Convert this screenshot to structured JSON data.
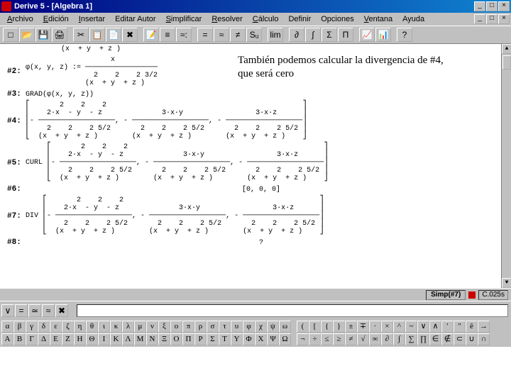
{
  "titlebar": {
    "title": "Derive 5 - [Algebra 1]"
  },
  "menubar": {
    "items": [
      "Archivo",
      "Edición",
      "Insertar",
      "Editar Autor",
      "Simplificar",
      "Resolver",
      "Cálculo",
      "Definir",
      "Opciones",
      "Ventana",
      "Ayuda"
    ]
  },
  "toolbar": {
    "icons": [
      "new-icon",
      "open-icon",
      "save-icon",
      "print-icon",
      "cut-icon",
      "copy-icon",
      "paste-icon",
      "delete-icon",
      "author-icon",
      "simplify-icon",
      "approx-icon",
      "equals-icon",
      "approxeq-icon",
      "unequal-icon",
      "sub-icon",
      "lim-icon",
      "partial-icon",
      "integral-icon",
      "sum-icon",
      "product-icon",
      "plot2d-icon",
      "plot3d-icon",
      "help-icon"
    ],
    "glyphs": [
      "□",
      "📂",
      "💾",
      "🖨",
      "✂",
      "📋",
      "📄",
      "✖",
      "📝",
      "≡",
      "≈:",
      "=",
      "≈",
      "≠",
      "Sᵤ",
      "lim",
      "∂",
      "∫",
      "Σ",
      "Π",
      "📈",
      "📊",
      "?"
    ]
  },
  "workspace": {
    "topline": "(x  + y  + z )",
    "rows": [
      {
        "label": "#2:",
        "expr": "                    x\nφ(x, y, z) := ─────────────────\n                2    2    2 3/2\n              (x  + y  + z )"
      },
      {
        "label": "#3:",
        "expr": "GRAD(φ(x, y, z))"
      },
      {
        "label": "#4:",
        "expr": "⎡       2    2    2                                              ⎤\n⎢    2·x  - y  - z              3·x·y                 3·x·z      ⎥\n⎢- ──────────────────, - ──────────────────, - ──────────────────⎥\n⎢    2    2    2 5/2       2    2    2 5/2       2    2    2 5/2 ⎥\n⎣  (x  + y  + z )        (x  + y  + z )        (x  + y  + z )    ⎦"
      },
      {
        "label": "#5:",
        "expr": "     ⎡       2    2    2                                              ⎤\n     ⎢    2·x  - y  - z              3·x·y                 3·x·z      ⎥\nCURL ⎢- ──────────────────, - ──────────────────, - ──────────────────⎥\n     ⎢    2    2    2 5/2       2    2    2 5/2       2    2    2 5/2 ⎥\n     ⎣  (x  + y  + z )        (x  + y  + z )        (x  + y  + z )    ⎦"
      },
      {
        "label": "#6:",
        "expr": "[0, 0, 0]",
        "center": true
      },
      {
        "label": "#7:",
        "expr": "    ⎡       2    2    2                                              ⎤\n    ⎢    2·x  - y  - z              3·x·y                 3·x·z      ⎥\nDIV ⎢- ──────────────────, - ──────────────────, - ──────────────────⎥\n    ⎢    2    2    2 5/2       2    2    2 5/2       2    2    2 5/2 ⎥\n    ⎣  (x  + y  + z )        (x  + y  + z )        (x  + y  + z )    ⎦"
      },
      {
        "label": "#8:",
        "expr": "?",
        "center": true
      }
    ]
  },
  "annotation": {
    "text": "También podemos calcular la divergencia de #4, que será cero"
  },
  "statusbar": {
    "center": "Simp(#7)",
    "time": "C.025s"
  },
  "inputbar": {
    "icons": [
      "∨",
      "=",
      "≃",
      "≈",
      "✖"
    ]
  },
  "greek": {
    "g1r1": [
      "α",
      "β",
      "γ",
      "δ",
      "ε",
      "ζ",
      "η",
      "θ",
      "ι",
      "κ",
      "λ",
      "μ",
      "ν",
      "ξ",
      "ο",
      "π",
      "ρ",
      "σ",
      "τ",
      "υ",
      "φ",
      "χ",
      "ψ",
      "ω"
    ],
    "g1r2": [
      "Α",
      "Β",
      "Γ",
      "Δ",
      "Ε",
      "Ζ",
      "Η",
      "Θ",
      "Ι",
      "Κ",
      "Λ",
      "Μ",
      "Ν",
      "Ξ",
      "Ο",
      "Π",
      "Ρ",
      "Σ",
      "Τ",
      "Υ",
      "Φ",
      "Χ",
      "Ψ",
      "Ω"
    ],
    "g2r1": [
      "(",
      "[",
      "{",
      "}",
      "±",
      "∓",
      "·",
      "×",
      "^",
      "~",
      "∨",
      "∧",
      "′",
      "″",
      "ê",
      "→"
    ],
    "g2r2": [
      "¬",
      "÷",
      "≤",
      "≥",
      "≠",
      "√",
      "∞",
      "∂",
      "∫",
      "∑",
      "∏",
      "∈",
      "∉",
      "⊂",
      "∪",
      "∩"
    ]
  }
}
